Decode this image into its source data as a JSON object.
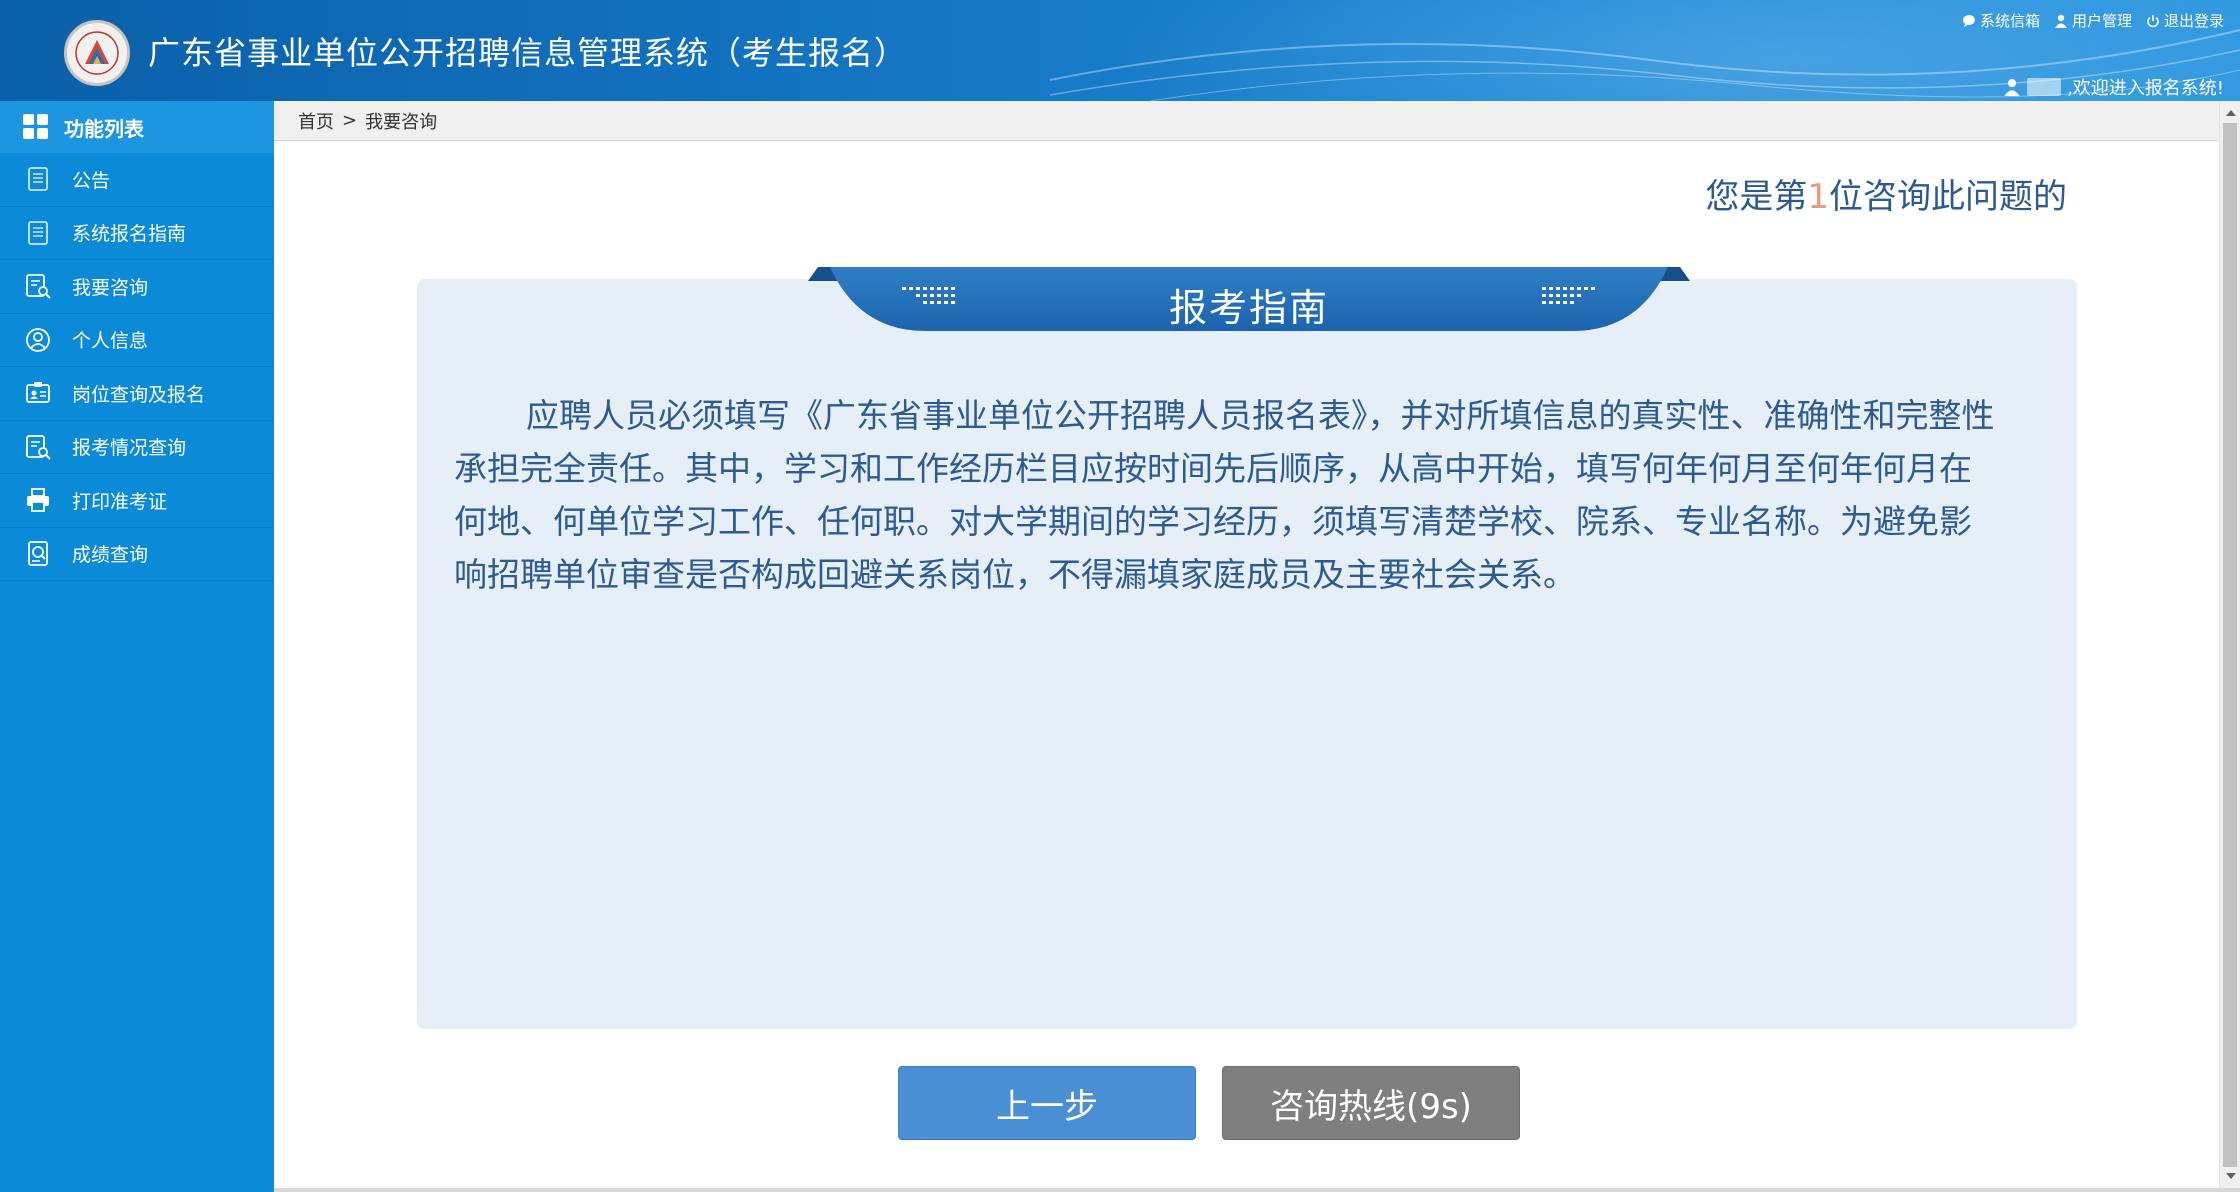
{
  "header": {
    "title": "广东省事业单位公开招聘信息管理系统（考生报名）",
    "links": [
      {
        "label": "系统信箱",
        "icon": "chat-icon"
      },
      {
        "label": "用户管理",
        "icon": "user-icon"
      },
      {
        "label": "退出登录",
        "icon": "power-icon"
      }
    ],
    "welcome": ",欢迎进入报名系统!"
  },
  "sidebar": {
    "heading": "功能列表",
    "items": [
      {
        "label": "公告",
        "icon": "document-icon"
      },
      {
        "label": "系统报名指南",
        "icon": "document-icon"
      },
      {
        "label": "我要咨询",
        "icon": "search-document-icon"
      },
      {
        "label": "个人信息",
        "icon": "person-icon"
      },
      {
        "label": "岗位查询及报名",
        "icon": "id-card-icon"
      },
      {
        "label": "报考情况查询",
        "icon": "search-document-icon"
      },
      {
        "label": "打印准考证",
        "icon": "printer-icon"
      },
      {
        "label": "成绩查询",
        "icon": "score-icon"
      }
    ]
  },
  "breadcrumb": {
    "home": "首页",
    "separator": ">",
    "current": "我要咨询"
  },
  "counter": {
    "prefix": "您是第",
    "number": "1",
    "suffix": "位咨询此问题的"
  },
  "guide": {
    "title": "报考指南",
    "text": "应聘人员必须填写《广东省事业单位公开招聘人员报名表》，并对所填信息的真实性、准确性和完整性承担完全责任。其中，学习和工作经历栏目应按时间先后顺序，从高中开始，填写何年何月至何年何月在何地、何单位学习工作、任何职。对大学期间的学习经历，须填写清楚学校、院系、专业名称。为避免影响招聘单位审查是否构成回避关系岗位，不得漏填家庭成员及主要社会关系。"
  },
  "buttons": {
    "prev": "上一步",
    "hotline": "咨询热线(9s)"
  },
  "colors": {
    "header": "#1476c4",
    "sidebar": "#0b8ad8",
    "panel": "#e6eef8",
    "text": "#2c5a93",
    "prev_button": "#4a8fd4",
    "hotline_button": "#7f7f7f"
  }
}
